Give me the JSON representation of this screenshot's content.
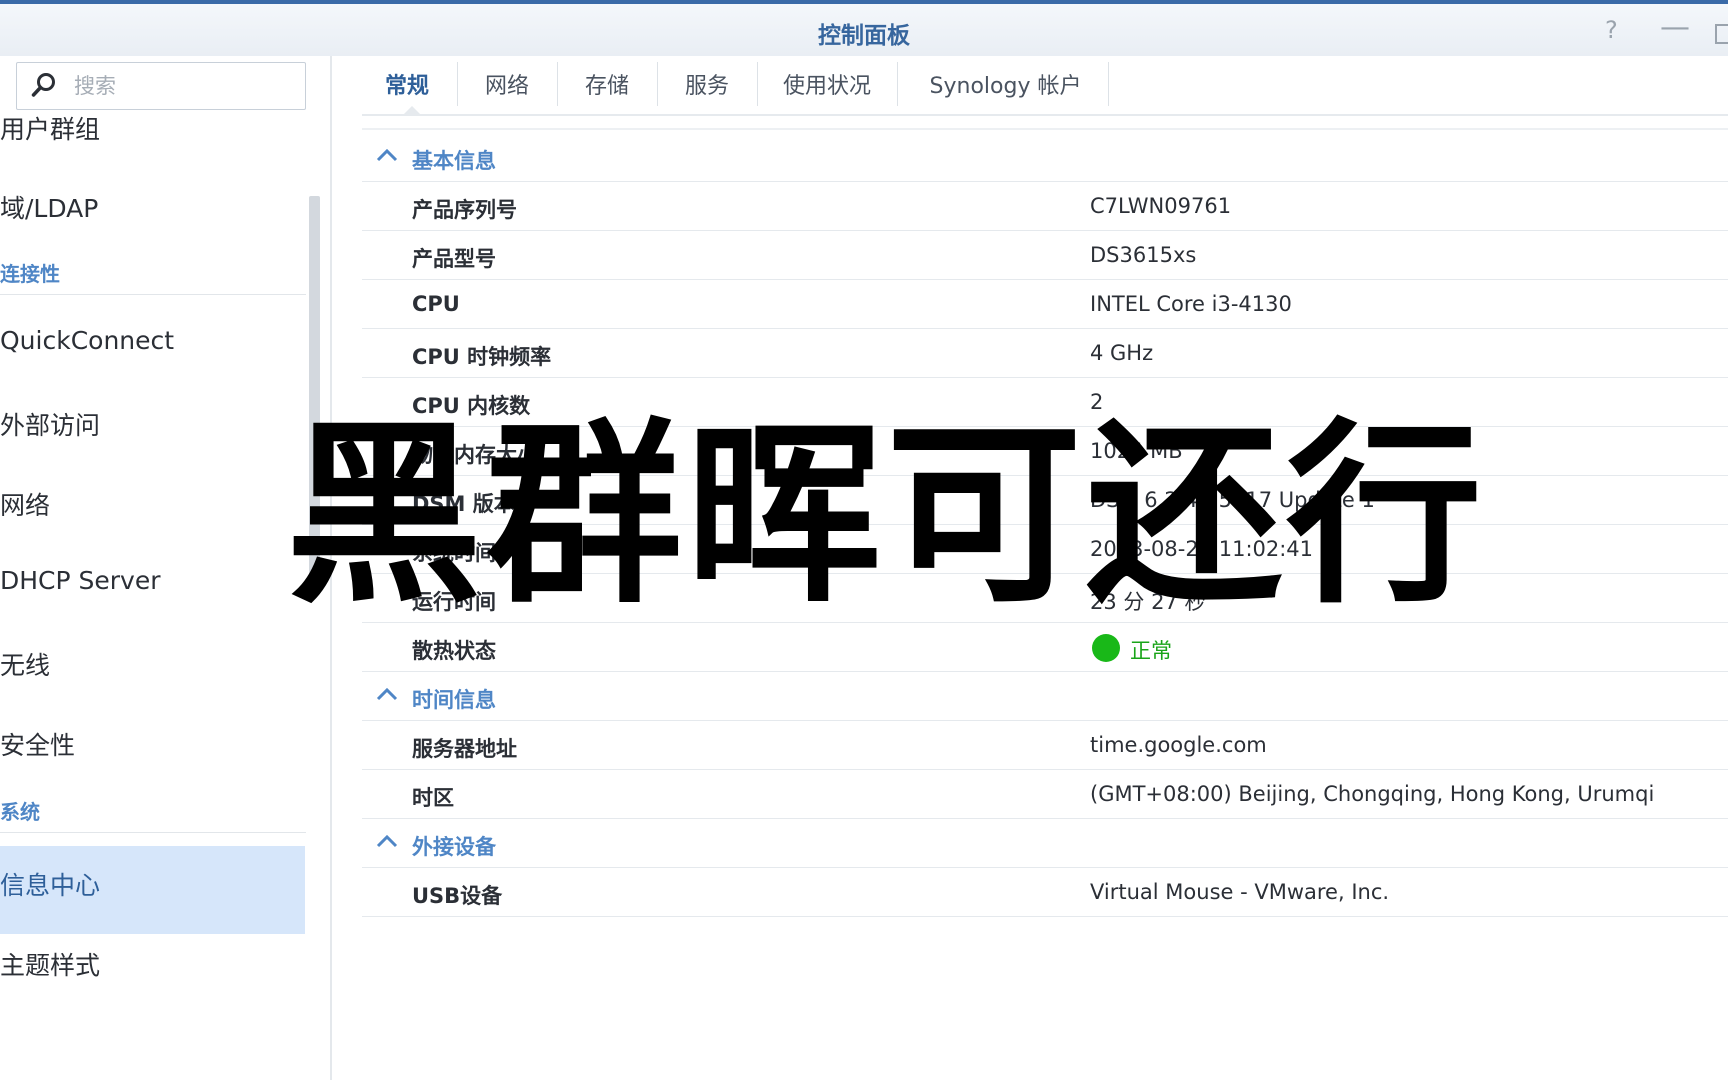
{
  "window": {
    "title": "控制面板",
    "help_icon": "question-icon",
    "min_icon": "minimize-icon",
    "max_icon": "maximize-icon"
  },
  "sidebar": {
    "search_placeholder": "搜索",
    "items": [
      {
        "label": "用户群组",
        "type": "item"
      },
      {
        "label": "域/LDAP",
        "type": "item"
      },
      {
        "label": "连接性",
        "type": "section"
      },
      {
        "label": "QuickConnect",
        "type": "item"
      },
      {
        "label": "外部访问",
        "type": "item"
      },
      {
        "label": "网络",
        "type": "item"
      },
      {
        "label": "DHCP Server",
        "type": "item"
      },
      {
        "label": "无线",
        "type": "item"
      },
      {
        "label": "安全性",
        "type": "item"
      },
      {
        "label": "系统",
        "type": "section"
      },
      {
        "label": "信息中心",
        "type": "item",
        "active": true
      },
      {
        "label": "主题样式",
        "type": "item"
      }
    ]
  },
  "tabs": [
    {
      "label": "常规",
      "active": true
    },
    {
      "label": "网络"
    },
    {
      "label": "存储"
    },
    {
      "label": "服务"
    },
    {
      "label": "使用状况"
    },
    {
      "label": "Synology 帐户"
    }
  ],
  "sections": [
    {
      "title": "基本信息",
      "rows": [
        {
          "label": "产品序列号",
          "value": "C7LWN09761"
        },
        {
          "label": "产品型号",
          "value": "DS3615xs"
        },
        {
          "label": "CPU",
          "value": "INTEL Core i3-4130"
        },
        {
          "label": "CPU 时钟频率",
          "value": "4 GHz"
        },
        {
          "label": "CPU 内核数",
          "value": "2"
        },
        {
          "label": "物理内存大小",
          "value": "1024 MB"
        },
        {
          "label": "DSM 版本",
          "value": "DSM 6.2.4-15217 Update 1"
        },
        {
          "label": "系统时间",
          "value": "2023-08-22 11:02:41"
        },
        {
          "label": "运行时间",
          "value": "23 分 27 秒"
        },
        {
          "label": "散热状态",
          "value": "正常",
          "status": "ok",
          "status_color": "#19b818"
        }
      ]
    },
    {
      "title": "时间信息",
      "rows": [
        {
          "label": "服务器地址",
          "value": "time.google.com"
        },
        {
          "label": "时区",
          "value": "(GMT+08:00) Beijing, Chongqing, Hong Kong, Urumqi"
        }
      ]
    },
    {
      "title": "外接设备",
      "rows": [
        {
          "label": "USB设备",
          "value": "Virtual Mouse - VMware, Inc."
        }
      ]
    }
  ],
  "overlay": {
    "caption": "黑群晖可还行"
  }
}
